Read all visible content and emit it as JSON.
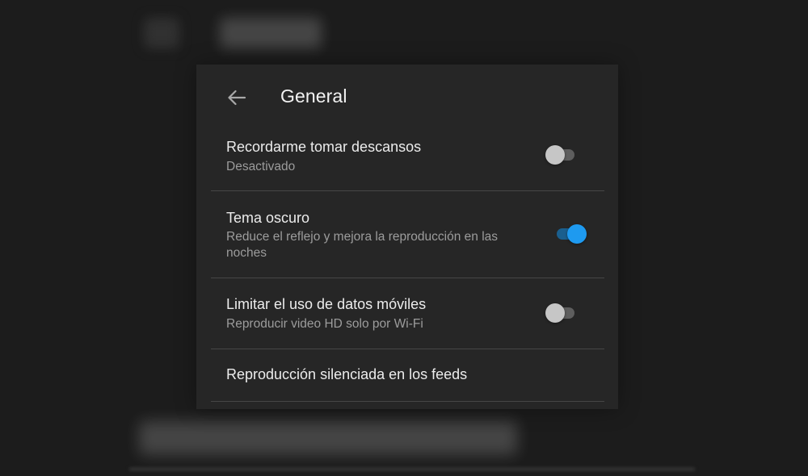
{
  "header": {
    "title": "General"
  },
  "settings": [
    {
      "title": "Recordarme tomar descansos",
      "subtitle": "Desactivado",
      "toggle": "off"
    },
    {
      "title": "Tema oscuro",
      "subtitle": "Reduce el reflejo y mejora la reproducción en las noches",
      "toggle": "on"
    },
    {
      "title": "Limitar el uso de datos móviles",
      "subtitle": "Reproducir video HD solo por Wi-Fi",
      "toggle": "off"
    },
    {
      "title": "Reproducción silenciada en los feeds"
    }
  ],
  "colors": {
    "toggle_on_knob": "#1e9af0",
    "toggle_on_track": "#1a5f8e",
    "toggle_off_knob": "#c6c6c6",
    "toggle_off_track": "#5e5e5e",
    "panel_background": "#262626"
  },
  "icons": {
    "back": "arrow-left-icon"
  }
}
